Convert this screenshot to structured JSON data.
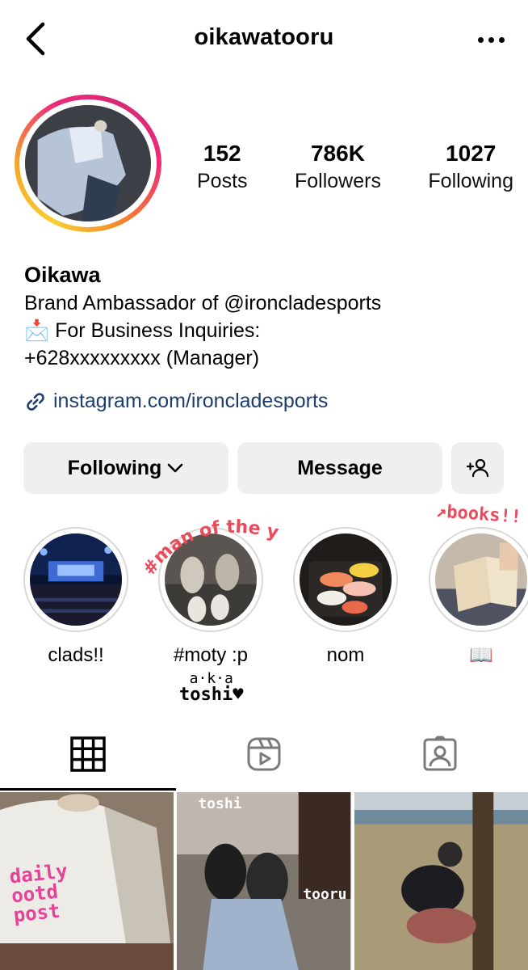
{
  "header": {
    "username": "oikawatooru"
  },
  "stats": [
    {
      "num": "152",
      "label": "Posts"
    },
    {
      "num": "786K",
      "label": "Followers"
    },
    {
      "num": "1027",
      "label": "Following"
    }
  ],
  "bio": {
    "name": "Oikawa",
    "line1": "Brand Ambassador of @ironcladesports",
    "line2": "📩 For Business Inquiries:",
    "line3": "+628xxxxxxxxx (Manager)",
    "link": "instagram.com/ironcladesports"
  },
  "actions": {
    "following": "Following",
    "message": "Message"
  },
  "highlights": [
    {
      "label": "clads!!"
    },
    {
      "label": "#moty :p"
    },
    {
      "label": "nom"
    },
    {
      "label": "📖"
    }
  ],
  "stickers": {
    "moty": "#man of the year",
    "books": "↗books!!",
    "aka_line1": "a·k·a",
    "aka_line2": "toshi♥",
    "post1": "daily ootd post",
    "post2_top": "toshi",
    "post2_bottom": "tooru"
  },
  "icons": {
    "back": "chevron-left-icon",
    "more": "more-horizontal-icon",
    "link": "link-icon",
    "add_user": "add-user-icon",
    "grid_tab": "grid-icon",
    "reels_tab": "reels-icon",
    "tagged_tab": "tagged-icon"
  },
  "colors": {
    "link": "#1d3d70",
    "button_bg": "#efefef",
    "sticker_red": "#ea4a5a",
    "sticker_pink": "#e7429a"
  }
}
